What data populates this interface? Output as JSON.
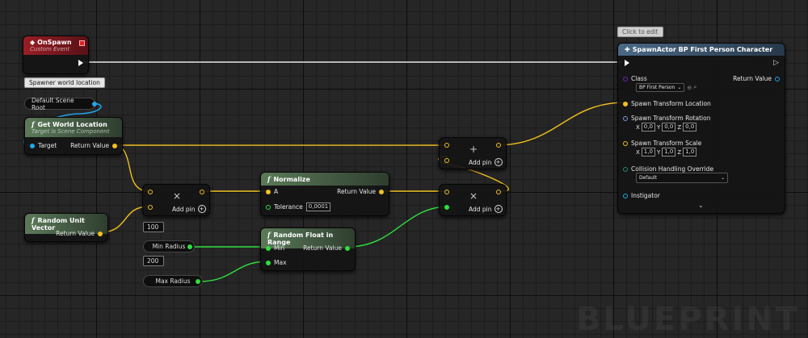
{
  "comments": {
    "spawner": "Spawner world location",
    "click_to_edit": "Click to edit"
  },
  "on_spawn": {
    "title": "OnSpawn",
    "subtitle": "Custom Event"
  },
  "default_scene_root": {
    "label": "Default Scene Root"
  },
  "get_world_location": {
    "title": "Get World Location",
    "subtitle": "Target is Scene Component",
    "target": "Target",
    "return_value": "Return Value"
  },
  "random_unit_vector": {
    "title": "Random Unit Vector",
    "return_value": "Return Value"
  },
  "add_node_1": {
    "symbol": "×",
    "add_pin": "Add pin"
  },
  "add_node_2": {
    "symbol": "+",
    "add_pin": "Add pin"
  },
  "add_node_3": {
    "symbol": "×",
    "add_pin": "Add pin"
  },
  "normalize": {
    "title": "Normalize",
    "a": "A",
    "return_value": "Return Value",
    "tolerance": "Tolerance",
    "tolerance_value": "0,0001"
  },
  "min_radius": {
    "literal": "100",
    "label": "Min Radius"
  },
  "max_radius": {
    "literal": "200",
    "label": "Max Radius"
  },
  "random_float": {
    "title": "Random Float in Range",
    "min": "Min",
    "max": "Max",
    "return_value": "Return Value"
  },
  "spawn_actor": {
    "title": "SpawnActor BP First Person Character",
    "class_label": "Class",
    "class_value": "BP First Person",
    "return_value": "Return Value",
    "transform_location": "Spawn Transform Location",
    "transform_rotation": "Spawn Transform Rotation",
    "rotation": {
      "x_label": "X",
      "x": "0,0",
      "y_label": "Y",
      "y": "0,0",
      "z_label": "Z",
      "z": "0,0"
    },
    "transform_scale": "Spawn Transform Scale",
    "scale": {
      "x_label": "X",
      "x": "1,0",
      "y_label": "Y",
      "y": "1,0",
      "z_label": "Z",
      "z": "1,0"
    },
    "collision_label": "Collision Handling Override",
    "collision_value": "Default",
    "instigator": "Instigator"
  },
  "watermark": "BLUEPRINT",
  "colors": {
    "exec": "#ffffff",
    "vector": "#f2c01f",
    "float": "#2fdf3e",
    "object": "#23a5ea",
    "class": "#6a1fb3"
  }
}
